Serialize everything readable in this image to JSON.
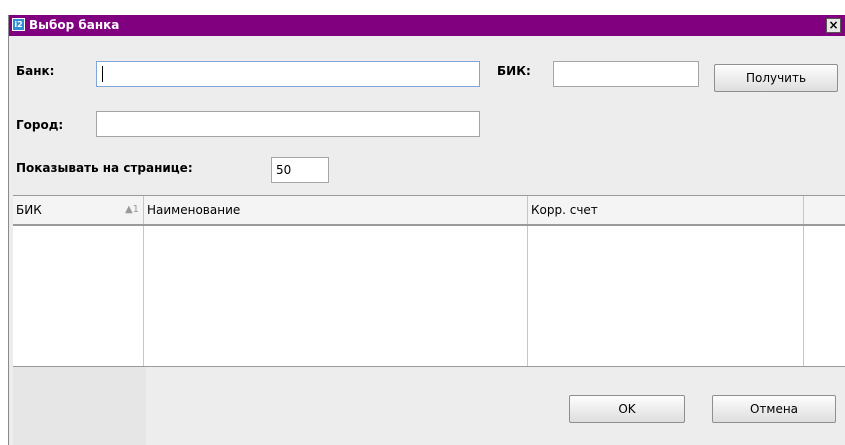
{
  "window": {
    "title": "Выбор банка",
    "icon": "app-icon",
    "close_label": "×",
    "title_bar_color": "#800080"
  },
  "form": {
    "bank_label": "Банк:",
    "bank_value": "",
    "bik_label": "БИК:",
    "bik_value": "",
    "fetch_button": "Получить",
    "city_label": "Город:",
    "city_value": "",
    "per_page_label": "Показывать на странице:",
    "per_page_value": "50"
  },
  "table": {
    "columns": [
      {
        "label": "БИК",
        "sort": "▲1"
      },
      {
        "label": "Наименование"
      },
      {
        "label": "Корр. счет"
      },
      {
        "label": ""
      }
    ],
    "rows": []
  },
  "footer": {
    "ok_button": "OK",
    "cancel_button": "Отмена"
  }
}
